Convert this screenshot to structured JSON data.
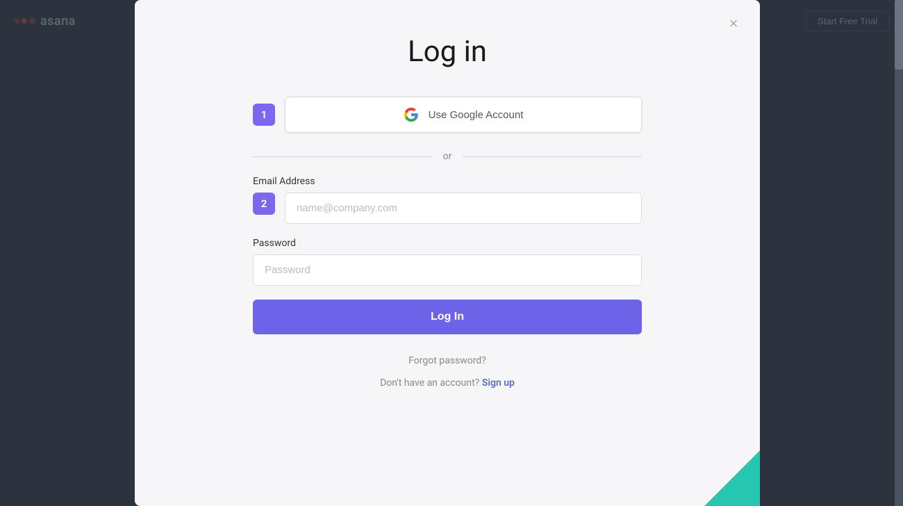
{
  "header": {
    "logo_text": "asana",
    "start_trial_label": "Start Free Trial"
  },
  "modal": {
    "title": "Log in",
    "close_label": "×",
    "google_button_label": "Use Google Account",
    "divider_text": "or",
    "step1_badge": "1",
    "step2_badge": "2",
    "email_label": "Email Address",
    "email_placeholder": "name@company.com",
    "password_label": "Password",
    "password_placeholder": "Password",
    "login_button_label": "Log In",
    "forgot_password_label": "Forgot password?",
    "no_account_text": "Don't have an account?",
    "signup_label": "Sign up"
  }
}
